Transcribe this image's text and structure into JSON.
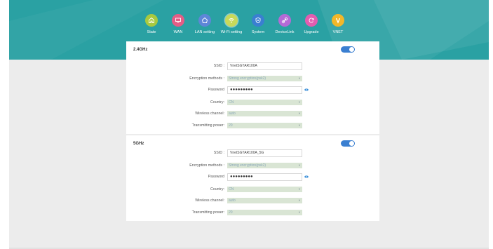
{
  "nav": {
    "items": [
      {
        "label": "State",
        "icon": "home-icon",
        "color": "#a8c93e"
      },
      {
        "label": "WAN",
        "icon": "monitor-icon",
        "color": "#e35d86"
      },
      {
        "label": "LAN setting",
        "icon": "house-icon",
        "color": "#5e86d8"
      },
      {
        "label": "Wi-Fi setting",
        "icon": "wifi-icon",
        "color": "#c8d95a"
      },
      {
        "label": "System",
        "icon": "shield-icon",
        "color": "#3a7fd1"
      },
      {
        "label": "DeviceLink",
        "icon": "link-icon",
        "color": "#b56ad6"
      },
      {
        "label": "Upgrade",
        "icon": "refresh-icon",
        "color": "#e35db0"
      },
      {
        "label": "VNET",
        "icon": "v-logo-icon",
        "color": "#f2b729"
      }
    ],
    "active": "Wi-Fi setting"
  },
  "bands": [
    {
      "title": "2.4GHz",
      "enabled": true,
      "ssid_label": "SSID :",
      "ssid_value": "VnetSGTAR100A",
      "encryption_label": "Encryption methods :",
      "encryption_value": "Strong encryption(psk2)",
      "password_label": "Password",
      "password_value": "●●●●●●●●●",
      "country_label": "Country:",
      "country_value": "CN",
      "channel_label": "Wireless channel:",
      "channel_value": "auto",
      "power_label": "Transmitting power:",
      "power_value": "20"
    },
    {
      "title": "5GHz",
      "enabled": true,
      "ssid_label": "SSID :",
      "ssid_value": "VnetSGTAR100A_5G",
      "encryption_label": "Encryption methods :",
      "encryption_value": "Strong encryption(psk2)",
      "password_label": "Password",
      "password_value": "●●●●●●●●●",
      "country_label": "Country:",
      "country_value": "CN",
      "channel_label": "Wireless channel:",
      "channel_value": "auto",
      "power_label": "Transmitting power:",
      "power_value": "20"
    }
  ],
  "colors": {
    "header": "#2aa1a3",
    "toggle_on": "#3a7fd1",
    "select_bg": "#d9e5d4"
  }
}
